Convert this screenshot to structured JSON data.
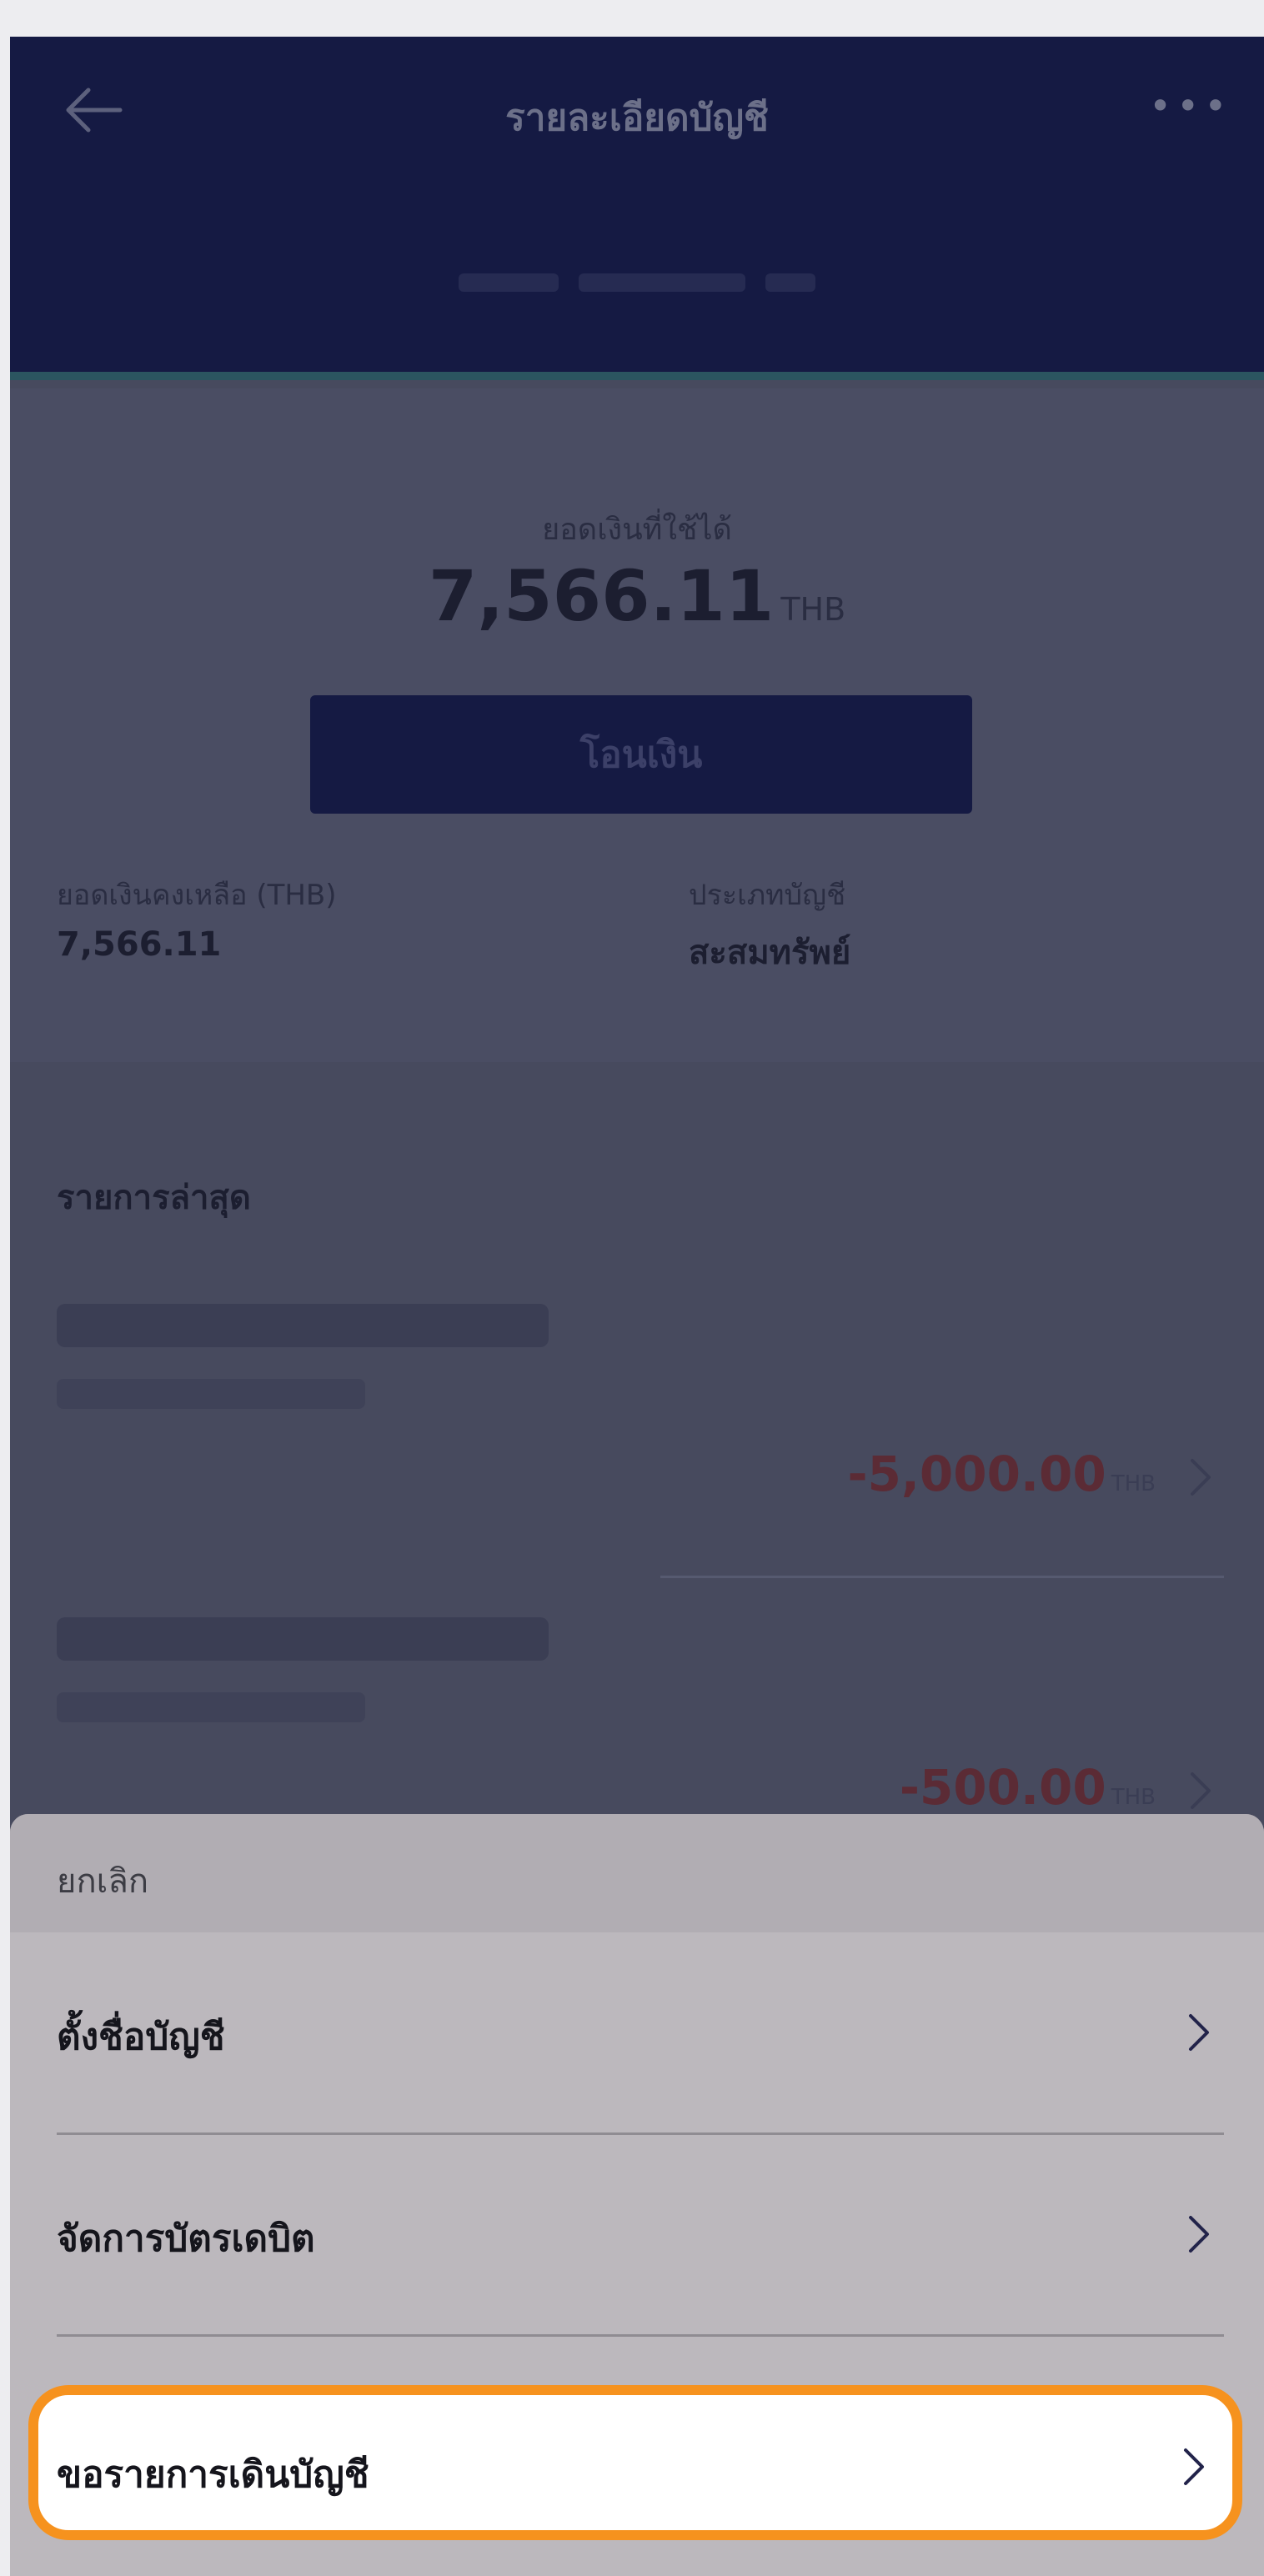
{
  "header": {
    "title": "รายละเอียดบัญชี",
    "more_label": "•••"
  },
  "balance": {
    "available_label": "ยอดเงินที่ใช้ได้",
    "available_amount": "7,566.11",
    "currency": "THB",
    "transfer_label": "โอนเงิน",
    "remaining_label": "ยอดเงินคงเหลือ (THB)",
    "remaining_value": "7,566.11",
    "account_type_label": "ประเภทบัญชี",
    "account_type_value": "สะสมทรัพย์"
  },
  "recent": {
    "title": "รายการล่าสุด",
    "transactions": [
      {
        "amount": "-5,000.00",
        "currency": "THB"
      },
      {
        "amount": "-500.00",
        "currency": "THB"
      }
    ]
  },
  "sheet": {
    "cancel_label": "ยกเลิก",
    "items": [
      {
        "label": "ตั้งชื่อบัญชี"
      },
      {
        "label": "จัดการบัตรเดบิต"
      },
      {
        "label": "ขอรายการเดินบัญชี"
      }
    ]
  },
  "colors": {
    "header_bg": "#151a43",
    "highlight_border": "#f6921e",
    "negative_amount": "#5b2b35"
  }
}
